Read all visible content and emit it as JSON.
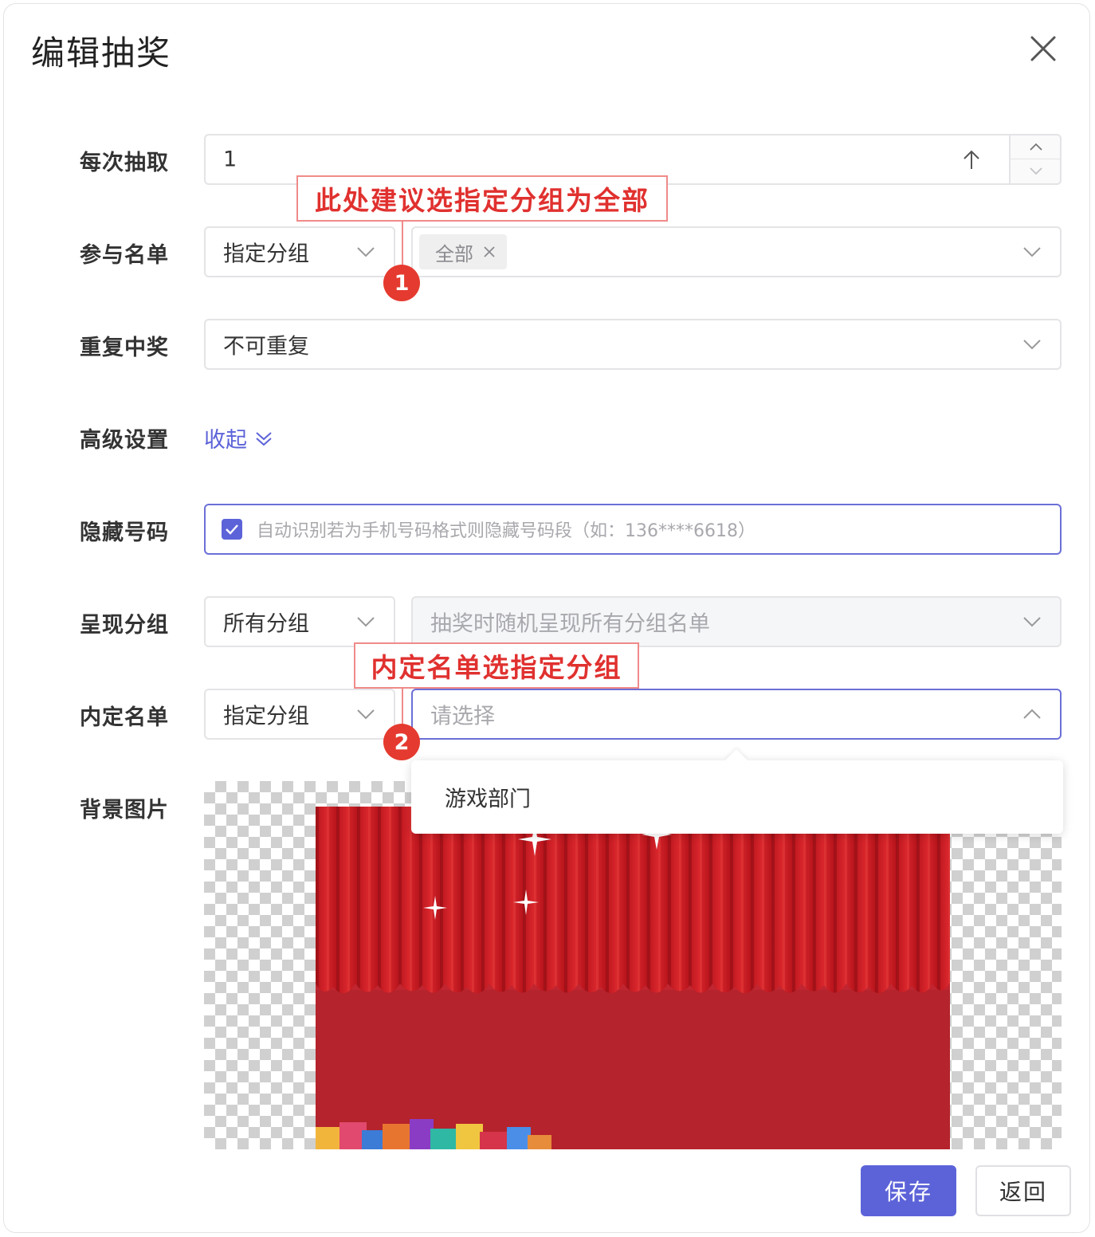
{
  "dialog": {
    "title": "编辑抽奖"
  },
  "labels": {
    "per_draw": "每次抽取",
    "participants": "参与名单",
    "repeat": "重复中奖",
    "advanced": "高级设置",
    "hide_number": "隐藏号码",
    "show_group": "呈现分组",
    "preset": "内定名单",
    "background": "背景图片"
  },
  "fields": {
    "per_draw_value": "1",
    "participants_mode": "指定分组",
    "participants_tag": "全部",
    "repeat_value": "不可重复",
    "advanced_toggle": "收起",
    "hide_number_hint": "自动识别若为手机号码格式则隐藏号码段（如：136****6618）",
    "show_group_mode": "所有分组",
    "show_group_placeholder": "抽奖时随机呈现所有分组名单",
    "preset_mode": "指定分组",
    "preset_placeholder": "请选择"
  },
  "dropdown": {
    "options": [
      "游戏部门"
    ]
  },
  "annotations": {
    "callout1": "此处建议选指定分组为全部",
    "badge1": "1",
    "callout2": "内定名单选指定分组",
    "badge2": "2"
  },
  "buttons": {
    "save": "保存",
    "back": "返回"
  },
  "colors": {
    "accent": "#5c63d8",
    "annotation": "#e0312f",
    "curtain": "#c8202a"
  }
}
